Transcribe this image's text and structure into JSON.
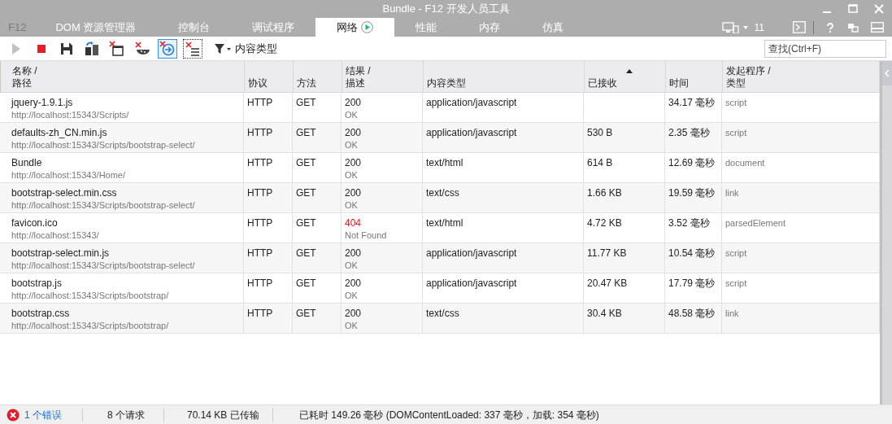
{
  "window": {
    "title": "Bundle - F12 开发人员工具"
  },
  "tabs": [
    {
      "label": "F12",
      "selected": false,
      "disabled": true
    },
    {
      "label": "DOM 资源管理器",
      "selected": false,
      "disabled": false
    },
    {
      "label": "控制台",
      "selected": false,
      "disabled": false
    },
    {
      "label": "调试程序",
      "selected": false,
      "disabled": false
    },
    {
      "label": "网络",
      "selected": true,
      "disabled": false
    },
    {
      "label": "性能",
      "selected": false,
      "disabled": false
    },
    {
      "label": "内存",
      "selected": false,
      "disabled": false
    },
    {
      "label": "仿真",
      "selected": false,
      "disabled": false
    }
  ],
  "document_mode": "11",
  "toolbar": [
    {
      "kind": "play",
      "disabled": true,
      "selected": false
    },
    {
      "kind": "stop",
      "disabled": false,
      "selected": false
    },
    {
      "kind": "save",
      "disabled": false,
      "selected": false
    },
    {
      "kind": "import",
      "disabled": false,
      "selected": false
    },
    {
      "kind": "clear-window",
      "disabled": false,
      "selected": false
    },
    {
      "kind": "clear-cookies",
      "disabled": false,
      "selected": false
    },
    {
      "kind": "refresh-server",
      "disabled": false,
      "selected": true
    },
    {
      "kind": "clear-entries",
      "disabled": false,
      "selected": false
    }
  ],
  "filter": {
    "label": "内容类型"
  },
  "search": {
    "placeholder": "查找(Ctrl+F)"
  },
  "table": {
    "columns": [
      {
        "label": "名称 /\n路径",
        "sorted": false
      },
      {
        "label": "协议",
        "sorted": false
      },
      {
        "label": "方法",
        "sorted": false
      },
      {
        "label": "结果 /\n描述",
        "sorted": false
      },
      {
        "label": "内容类型",
        "sorted": false
      },
      {
        "label": "已接收",
        "sorted": true
      },
      {
        "label": "时间",
        "sorted": false
      },
      {
        "label": "发起程序 /\n类型",
        "sorted": false
      }
    ],
    "rows": [
      {
        "name": "jquery-1.9.1.js",
        "path": "http://localhost:15343/Scripts/",
        "protocol": "HTTP",
        "method": "GET",
        "result": "200",
        "description": "OK",
        "error": false,
        "content_type": "application/javascript",
        "received": "",
        "time": "34.17 毫秒",
        "initiator": "script"
      },
      {
        "name": "defaults-zh_CN.min.js",
        "path": "http://localhost:15343/Scripts/bootstrap-select/",
        "protocol": "HTTP",
        "method": "GET",
        "result": "200",
        "description": "OK",
        "error": false,
        "content_type": "application/javascript",
        "received": "530 B",
        "time": "2.35 毫秒",
        "initiator": "script"
      },
      {
        "name": "Bundle",
        "path": "http://localhost:15343/Home/",
        "protocol": "HTTP",
        "method": "GET",
        "result": "200",
        "description": "OK",
        "error": false,
        "content_type": "text/html",
        "received": "614 B",
        "time": "12.69 毫秒",
        "initiator": "document"
      },
      {
        "name": "bootstrap-select.min.css",
        "path": "http://localhost:15343/Scripts/bootstrap-select/",
        "protocol": "HTTP",
        "method": "GET",
        "result": "200",
        "description": "OK",
        "error": false,
        "content_type": "text/css",
        "received": "1.66 KB",
        "time": "19.59 毫秒",
        "initiator": "link"
      },
      {
        "name": "favicon.ico",
        "path": "http://localhost:15343/",
        "protocol": "HTTP",
        "method": "GET",
        "result": "404",
        "description": "Not Found",
        "error": true,
        "content_type": "text/html",
        "received": "4.72 KB",
        "time": "3.52 毫秒",
        "initiator": "parsedElement"
      },
      {
        "name": "bootstrap-select.min.js",
        "path": "http://localhost:15343/Scripts/bootstrap-select/",
        "protocol": "HTTP",
        "method": "GET",
        "result": "200",
        "description": "OK",
        "error": false,
        "content_type": "application/javascript",
        "received": "11.77 KB",
        "time": "10.54 毫秒",
        "initiator": "script"
      },
      {
        "name": "bootstrap.js",
        "path": "http://localhost:15343/Scripts/bootstrap/",
        "protocol": "HTTP",
        "method": "GET",
        "result": "200",
        "description": "OK",
        "error": false,
        "content_type": "application/javascript",
        "received": "20.47 KB",
        "time": "17.79 毫秒",
        "initiator": "script"
      },
      {
        "name": "bootstrap.css",
        "path": "http://localhost:15343/Scripts/bootstrap/",
        "protocol": "HTTP",
        "method": "GET",
        "result": "200",
        "description": "OK",
        "error": false,
        "content_type": "text/css",
        "received": "30.4 KB",
        "time": "48.58 毫秒",
        "initiator": "link"
      }
    ]
  },
  "status_bar": {
    "errors": "1 个错误",
    "requests": "8 个请求",
    "transferred": "70.14 KB 已传输",
    "timing": "已耗时 149.26 毫秒 (DOMContentLoaded: 337 毫秒，加载: 354 毫秒)"
  }
}
